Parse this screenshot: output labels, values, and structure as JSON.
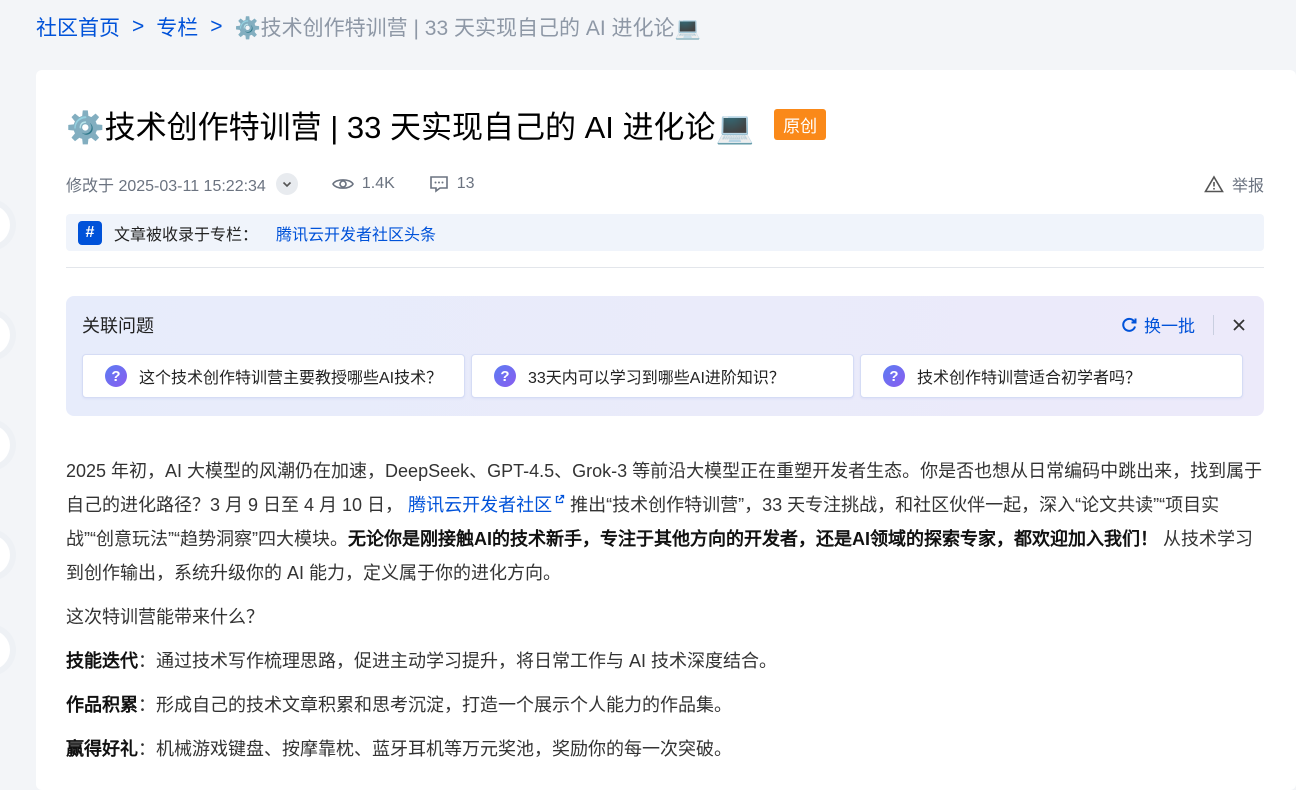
{
  "breadcrumb": {
    "home": "社区首页",
    "column": "专栏",
    "separator": ">",
    "current": "⚙️技术创作特训营 | 33 天实现自己的 AI 进化论💻"
  },
  "article": {
    "title": "⚙️技术创作特训营 | 33 天实现自己的 AI 进化论💻",
    "badge": "原创",
    "modified": "修改于 2025-03-11 15:22:34",
    "views": "1.4K",
    "comments": "13",
    "report": "举报",
    "column_label": "文章被收录于专栏：",
    "column_name": "腾讯云开发者社区头条"
  },
  "related": {
    "title": "关联问题",
    "refresh": "换一批",
    "questions": [
      "这个技术创作特训营主要教授哪些AI技术？",
      "33天内可以学习到哪些AI进阶知识？",
      "技术创作特训营适合初学者吗？"
    ]
  },
  "body": {
    "p1_a": "2025 年初，AI 大模型的风潮仍在加速，DeepSeek、GPT-4.5、Grok-3 等前沿大模型正在重塑开发者生态。你是否也想从日常编码中跳出来，找到属于自己的进化路径？3 月 9 日至 4 月 10 日，",
    "p1_link": "腾讯云开发者社区",
    "p1_b": "推出“技术创作特训营”，33 天专注挑战，和社区伙伴一起，深入“论文共读”“项目实战”“创意玩法”“趋势洞察”四大模块。",
    "p1_bold": "无论你是刚接触AI的技术新手，专注于其他方向的开发者，还是AI领域的探索专家，都欢迎加入我们！",
    "p1_c": "从技术学习到创作输出，系统升级你的 AI 能力，定义属于你的进化方向。",
    "p2": "这次特训营能带来什么？",
    "items": [
      {
        "label": "技能迭代",
        "text": "：通过技术写作梳理思路，促进主动学习提升，将日常工作与 AI 技术深度结合。"
      },
      {
        "label": "作品积累",
        "text": "：形成自己的技术文章积累和思考沉淀，打造一个展示个人能力的作品集。"
      },
      {
        "label": "赢得好礼",
        "text": "：机械游戏键盘、按摩靠枕、蓝牙耳机等万元奖池，奖励你的每一次突破。"
      }
    ]
  }
}
